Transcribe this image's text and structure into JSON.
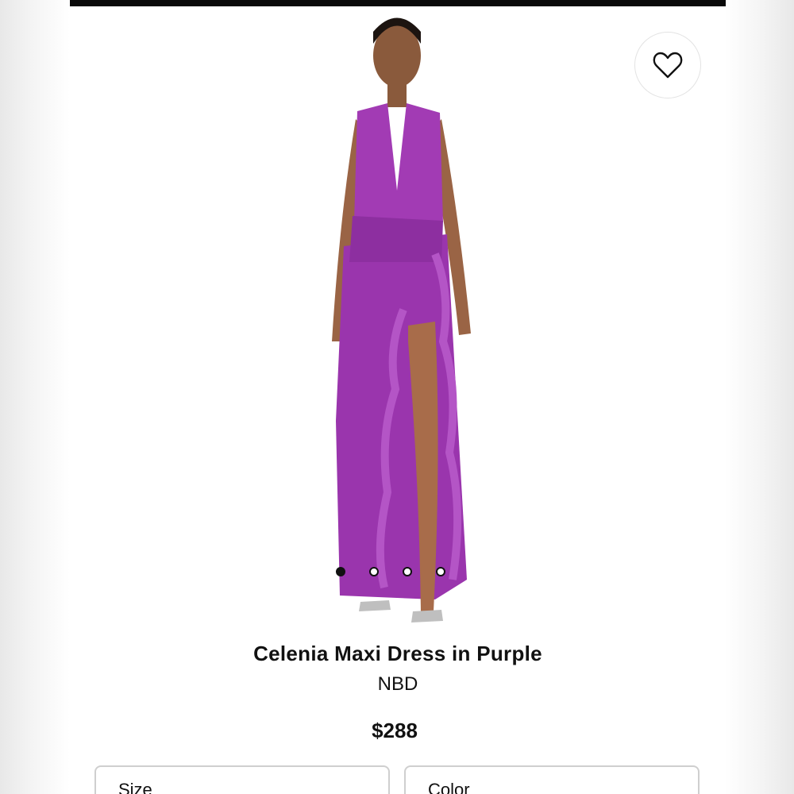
{
  "product": {
    "name": "Celenia Maxi Dress in Purple",
    "brand": "NBD",
    "price": "$288",
    "color_hex": "#a23bb4"
  },
  "gallery": {
    "image_count": 4,
    "active_index": 0
  },
  "selectors": {
    "size_label": "Size",
    "color_label": "Color"
  },
  "icons": {
    "wishlist": "heart-outline-icon"
  }
}
